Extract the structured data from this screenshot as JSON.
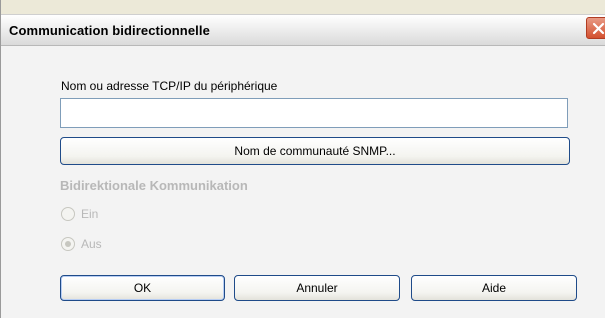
{
  "dialog": {
    "title": "Communication bidirectionnelle",
    "close_icon": "close-icon"
  },
  "tcp": {
    "label": "Nom ou adresse TCP/IP du périphérique",
    "value": ""
  },
  "snmp_button": "Nom de communauté SNMP...",
  "bidi": {
    "group_title": "Bidirektionale Kommunikation",
    "options": [
      {
        "label": "Ein",
        "checked": false,
        "enabled": false
      },
      {
        "label": "Aus",
        "checked": true,
        "enabled": false
      }
    ]
  },
  "buttons": {
    "ok": "OK",
    "cancel": "Annuler",
    "help": "Aide"
  },
  "colors": {
    "close_button": "#d3502f",
    "button_border": "#1f4b89",
    "disabled_text": "#b8b8b8"
  }
}
